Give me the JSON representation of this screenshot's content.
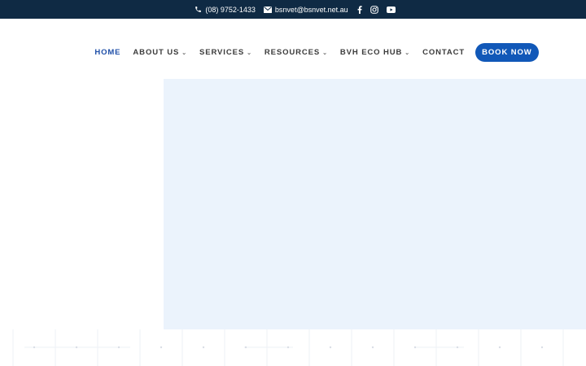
{
  "topbar": {
    "phone": "(08) 9752-1433",
    "email": "bsnvet@bsnvet.net.au",
    "social_icons": [
      "facebook-icon",
      "instagram-icon",
      "youtube-icon"
    ],
    "bg_color": "#0f2a44"
  },
  "nav": {
    "items": [
      {
        "label": "HOME",
        "active": true,
        "dropdown": false
      },
      {
        "label": "ABOUT US",
        "active": false,
        "dropdown": true
      },
      {
        "label": "SERVICES",
        "active": false,
        "dropdown": true
      },
      {
        "label": "RESOURCES",
        "active": false,
        "dropdown": true
      },
      {
        "label": "BVH ECO HUB",
        "active": false,
        "dropdown": true
      },
      {
        "label": "CONTACT",
        "active": false,
        "dropdown": false
      }
    ],
    "cta_label": "BOOK NOW",
    "accent_color": "#1158b8"
  },
  "hero": {
    "panel_color": "#ebf3fc"
  }
}
